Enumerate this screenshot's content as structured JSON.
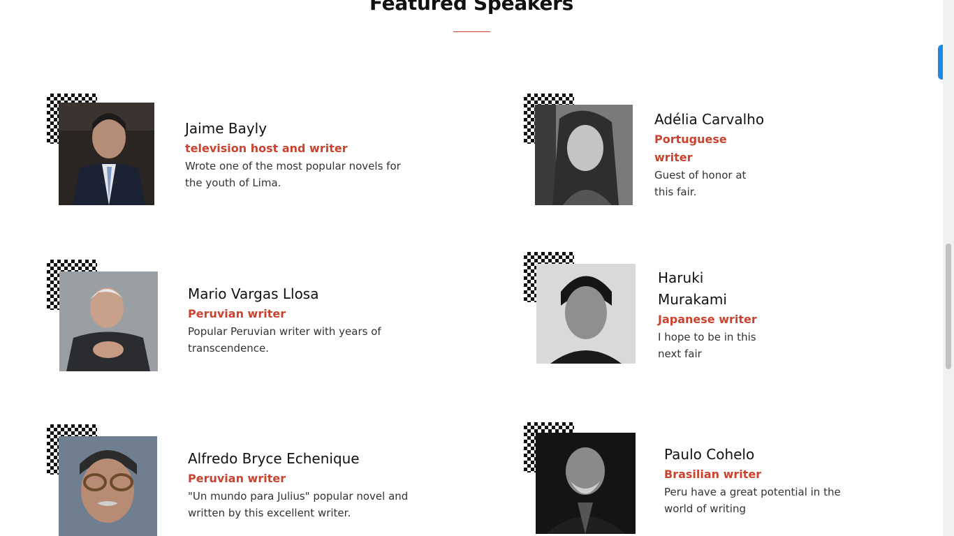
{
  "section": {
    "title": "Featured Speakers",
    "accent_color": "#c9432e"
  },
  "speakers": [
    {
      "name": "Jaime Bayly",
      "role": "television host and writer",
      "description": "Wrote one of the most popular novels for the youth of Lima.",
      "photo": "portrait-jaime-bayly"
    },
    {
      "name": "Adélia Carvalho",
      "role": "Portuguese writer",
      "description": "Guest of honor at this fair.",
      "photo": "portrait-adelia-carvalho"
    },
    {
      "name": "Mario Vargas Llosa",
      "role": "Peruvian writer",
      "description": "Popular Peruvian writer with years of transcendence.",
      "photo": "portrait-mario-vargas-llosa"
    },
    {
      "name": "Haruki Murakami",
      "role": "Japanese writer",
      "description": "I hope to be in this next fair",
      "photo": "portrait-haruki-murakami"
    },
    {
      "name": "Alfredo Bryce Echenique",
      "role": "Peruvian writer",
      "description": "\"Un mundo para Julius\" popular novel and written by this excellent writer.",
      "photo": "portrait-alfredo-bryce-echenique"
    },
    {
      "name": "Paulo Cohelo",
      "role": "Brasilian writer",
      "description": "Peru have a great potential in the world of writing",
      "photo": "portrait-paulo-cohelo"
    }
  ]
}
